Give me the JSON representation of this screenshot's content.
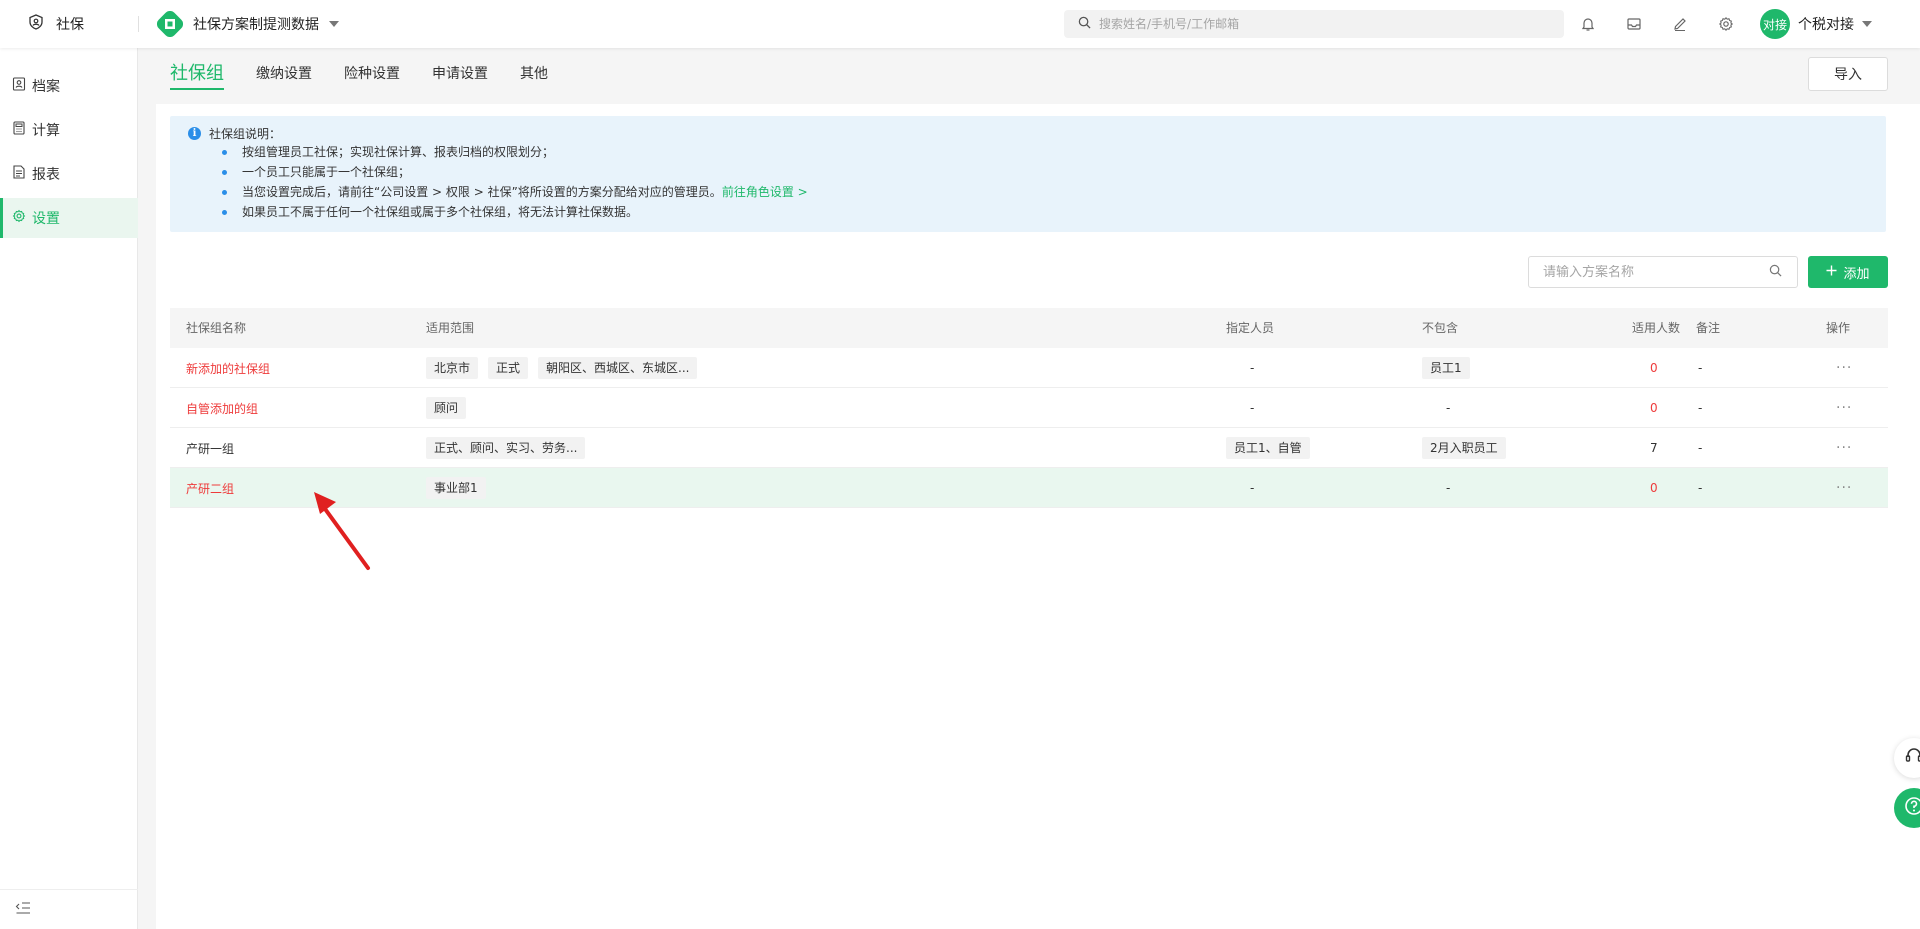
{
  "topbar": {
    "brand_label": "社保",
    "company_name": "社保方案制提测数据",
    "search_placeholder": "搜索姓名/手机号/工作邮箱",
    "avatar_text": "对接",
    "user_name": "个税对接"
  },
  "sidebar": {
    "items": [
      {
        "label": "档案",
        "icon": "archive-icon"
      },
      {
        "label": "计算",
        "icon": "calculator-icon"
      },
      {
        "label": "报表",
        "icon": "report-icon"
      },
      {
        "label": "设置",
        "icon": "gear-icon"
      }
    ]
  },
  "tabs": [
    {
      "label": "社保组"
    },
    {
      "label": "缴纳设置"
    },
    {
      "label": "险种设置"
    },
    {
      "label": "申请设置"
    },
    {
      "label": "其他"
    }
  ],
  "import_label": "导入",
  "notice": {
    "title": "社保组说明：",
    "items": [
      "按组管理员工社保；实现社保计算、报表归档的权限划分；",
      "一个员工只能属于一个社保组；",
      "当您设置完成后，请前往“公司设置 > 权限 > 社保”将所设置的方案分配给对应的管理员。",
      "如果员工不属于任何一个社保组或属于多个社保组，将无法计算社保数据。"
    ],
    "link": "前往角色设置 >"
  },
  "toolbar": {
    "search_placeholder": "请输入方案名称",
    "add_label": "添加"
  },
  "table": {
    "headers": {
      "name": "社保组名称",
      "scope": "适用范围",
      "assigned": "指定人员",
      "excluded": "不包含",
      "count": "适用人数",
      "note": "备注",
      "ops": "操作"
    },
    "rows": [
      {
        "name": "新添加的社保组",
        "scope": [
          "北京市",
          "正式",
          "朝阳区、西城区、东城区..."
        ],
        "assigned": "-",
        "excluded": "员工1",
        "count": "0",
        "note": "-",
        "ops": "···"
      },
      {
        "name": "自管添加的组",
        "scope": [
          "顾问"
        ],
        "assigned": "-",
        "excluded": "-",
        "count": "0",
        "note": "-",
        "ops": "···"
      },
      {
        "name": "产研一组",
        "scope": [
          "正式、顾问、实习、劳务..."
        ],
        "assigned": "员工1、自管",
        "excluded": "2月入职员工",
        "count": "7",
        "note": "-",
        "ops": "···"
      },
      {
        "name": "产研二组",
        "scope": [
          "事业部1"
        ],
        "assigned": "-",
        "excluded": "-",
        "count": "0",
        "note": "-",
        "ops": "···"
      }
    ]
  },
  "colors": {
    "accent": "#1fb86b",
    "highlight_row": "#e9f7ef",
    "warning_text": "#ee3b3b",
    "info_blue": "#2a8ee8",
    "annotation_arrow": "#e02020"
  }
}
